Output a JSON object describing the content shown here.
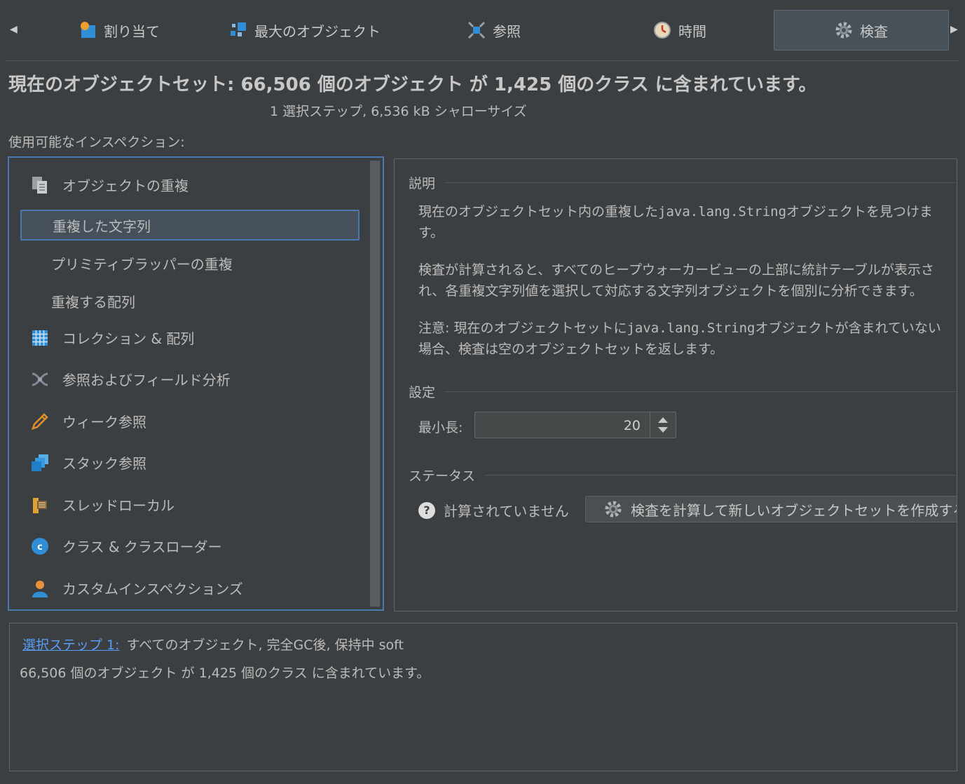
{
  "tabs": [
    {
      "label": "割り当て",
      "icon": "allocation-icon"
    },
    {
      "label": "最大のオブジェクト",
      "icon": "biggest-objects-icon"
    },
    {
      "label": "参照",
      "icon": "references-icon"
    },
    {
      "label": "時間",
      "icon": "clock-icon"
    },
    {
      "label": "検査",
      "icon": "gear-icon",
      "active": true
    }
  ],
  "header": {
    "title": "現在のオブジェクトセット:  66,506 個のオブジェクト が 1,425 個のクラス に含まれています。",
    "subtitle": "1 選択ステップ, 6,536 kB シャローサイズ"
  },
  "inspections": {
    "label": "使用可能なインスペクション:",
    "items": [
      {
        "label": "オブジェクトの重複",
        "icon": "duplicate-objects-icon"
      },
      {
        "label": "重複した文字列",
        "sub": true,
        "selected": true
      },
      {
        "label": "プリミティブラッパーの重複",
        "sub": true
      },
      {
        "label": "重複する配列",
        "sub": true
      },
      {
        "label": "コレクション & 配列",
        "icon": "collections-icon"
      },
      {
        "label": "参照およびフィールド分析",
        "icon": "reference-analysis-icon"
      },
      {
        "label": "ウィーク参照",
        "icon": "weak-reference-icon"
      },
      {
        "label": "スタック参照",
        "icon": "stack-reference-icon"
      },
      {
        "label": "スレッドローカル",
        "icon": "thread-local-icon"
      },
      {
        "label": "クラス & クラスローダー",
        "icon": "class-icon"
      },
      {
        "label": "カスタムインスペクションズ",
        "icon": "custom-user-icon"
      }
    ]
  },
  "detail": {
    "description_label": "説明",
    "desc1_a": "現在のオブジェクトセット内の重複した",
    "desc1_code": "java.lang.String",
    "desc1_b": "オブジェクトを見つけま",
    "desc1_line2": "す。",
    "desc2_line1": "検査が計算されると、すべてのヒープウォーカービューの上部に統計テーブルが表示さ",
    "desc2_line2": "れ、各重複文字列値を選択して対応する文字列オブジェクトを個別に分析できます。",
    "desc3_a": "注意: 現在のオブジェクトセットに",
    "desc3_code": "java.lang.String",
    "desc3_b": "オブジェクトが含まれていない",
    "desc3_line2": "場合、検査は空のオブジェクトセットを返します。",
    "settings_label": "設定",
    "min_length_label": "最小長:",
    "min_length_value": "20",
    "status_label": "ステータス",
    "status_text": "計算されていません",
    "calc_button": "検査を計算して新しいオブジェクトセットを作成する"
  },
  "bottom": {
    "step_link": "選択ステップ 1:",
    "step_desc": "すべてのオブジェクト, 完全GC後, 保持中 soft",
    "summary": "66,506 個のオブジェクト が 1,425 個のクラス に含まれています。"
  }
}
